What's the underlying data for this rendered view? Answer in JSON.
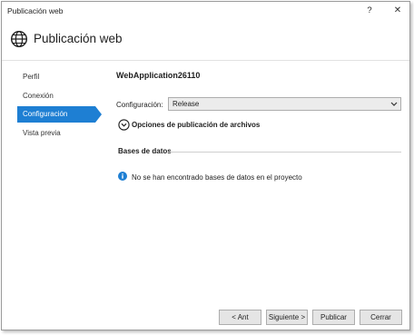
{
  "window": {
    "title": "Publicación web",
    "help_label": "?",
    "close_label": "✕"
  },
  "header": {
    "title": "Publicación web",
    "icon": "globe-icon"
  },
  "nav": {
    "items": [
      {
        "label": "Perfil",
        "active": false
      },
      {
        "label": "Conexión",
        "active": false
      },
      {
        "label": "Configuración",
        "active": true
      },
      {
        "label": "Vista previa",
        "active": false
      }
    ],
    "active_color": "#1e7fd3"
  },
  "main": {
    "project_name": "WebApplication26110",
    "config_label": "Configuración:",
    "config_value": "Release",
    "file_options_label": "Opciones de publicación de archivos",
    "databases_title": "Bases de datos",
    "databases_message": "No se han encontrado bases de datos en el proyecto",
    "info_icon": "info-icon",
    "info_color": "#1e7fd3"
  },
  "footer": {
    "back_label": "< Ant",
    "next_label": "Siguiente >",
    "publish_label": "Publicar",
    "close_label": "Cerrar"
  }
}
